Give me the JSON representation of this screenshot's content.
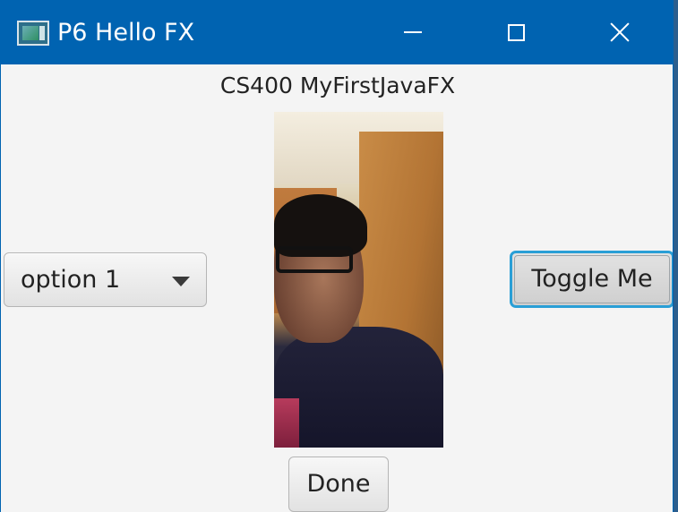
{
  "window": {
    "title": "P6 Hello FX",
    "icon": "java-app-icon"
  },
  "caption_buttons": {
    "minimize": "minimize-icon",
    "maximize": "maximize-icon",
    "close": "close-icon"
  },
  "content": {
    "heading": "CS400 MyFirstJavaFX",
    "combo_box": {
      "selected": "option 1"
    },
    "toggle_button": {
      "label": "Toggle Me"
    },
    "done_button": {
      "label": "Done"
    }
  },
  "colors": {
    "titlebar": "#0063b1",
    "focus_ring": "#2a9fd6",
    "background": "#f4f4f4"
  }
}
